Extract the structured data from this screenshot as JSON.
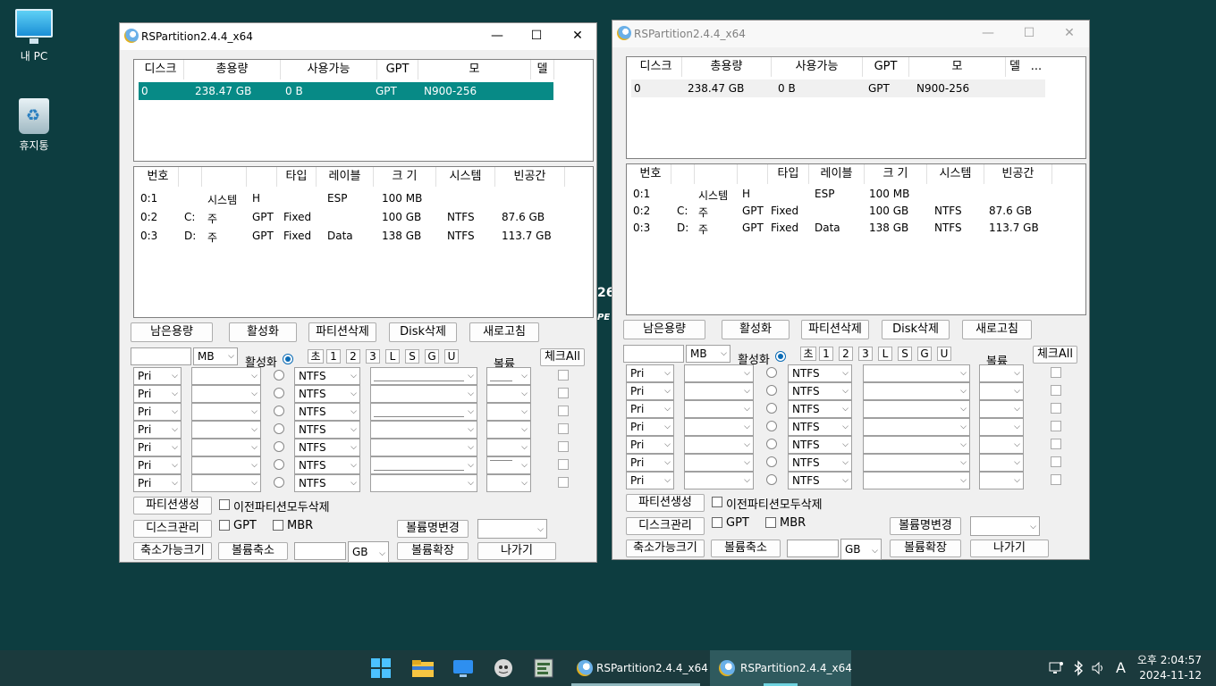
{
  "desktop": {
    "icons": [
      {
        "label": "내 PC"
      },
      {
        "label": "휴지통"
      }
    ],
    "bg_fragment_top": "26",
    "bg_fragment_bottom": "PE"
  },
  "win": {
    "title": "RSPartition2.4.4_x64",
    "controls": {
      "minimize": "—",
      "maximize": "☐",
      "close": "✕"
    },
    "disk_headers": [
      "디스크",
      "총용량",
      "사용가능",
      "GPT",
      "모",
      "델",
      "..."
    ],
    "disk_rows": [
      {
        "disk": "0",
        "total": "238.47 GB",
        "avail": "0 B",
        "gpt": "GPT",
        "model": "N900-256"
      }
    ],
    "part_headers": [
      "번호",
      "",
      "",
      "",
      "타입",
      "레이블",
      "크 기",
      "시스템",
      "빈공간"
    ],
    "part_rows": [
      {
        "num": "0:1",
        "drive": "",
        "kind": "시스템",
        "flag": "H",
        "type": "",
        "label": "ESP",
        "size": "100 MB",
        "fs": "",
        "free": ""
      },
      {
        "num": "0:2",
        "drive": "C:",
        "kind": "주",
        "flag": "GPT",
        "type": "Fixed",
        "label": "",
        "size": "100 GB",
        "fs": "NTFS",
        "free": "87.6 GB"
      },
      {
        "num": "0:3",
        "drive": "D:",
        "kind": "주",
        "flag": "GPT",
        "type": "Fixed",
        "label": "Data",
        "size": "138 GB",
        "fs": "NTFS",
        "free": "113.7 GB"
      }
    ],
    "buttons": {
      "remaining": "남은용량",
      "activate": "활성화",
      "delete_partition": "파티션삭제",
      "delete_disk": "Disk삭제",
      "refresh": "새로고침",
      "check_all": "체크All",
      "create_partition": "파티션생성",
      "disk_management": "디스크관리",
      "rename_volume": "볼륨명변경",
      "shrinkable_size": "축소가능크기",
      "shrink_volume": "볼륨축소",
      "extend_volume": "볼륨확장",
      "exit": "나가기"
    },
    "unit_mb": "MB",
    "unit_gb": "GB",
    "activate_label": "활성화",
    "volume_label": "볼륨",
    "size_buttons": [
      "초",
      "1",
      "2",
      "3",
      "L",
      "S",
      "G",
      "U"
    ],
    "row_type": "Pri",
    "row_fs": "NTFS",
    "delete_all_prev": "이전파티션모두삭제",
    "gpt_label": "GPT",
    "mbr_label": "MBR"
  },
  "taskbar": {
    "tasks": [
      {
        "title": "RSPartition2.4.4_x64"
      },
      {
        "title": "RSPartition2.4.4_x64"
      }
    ],
    "ime": "A",
    "time": "오후 2:04:57",
    "date": "2024-11-12"
  }
}
